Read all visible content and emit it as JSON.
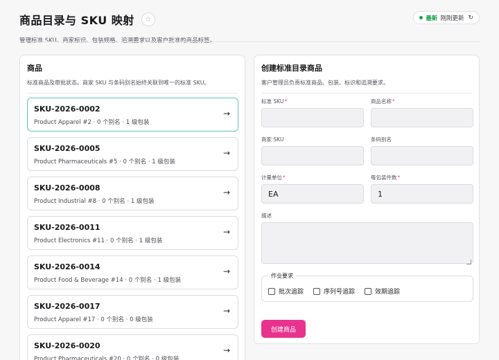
{
  "header": {
    "title": "商品目录与  SKU  映射",
    "star_icon": "star-icon",
    "subtitle": "管理标准 SKU、商家标识、包装规格、追溯要求以及客户批准的商品标签。",
    "status": {
      "badge": "最新",
      "time": "刚刚更新",
      "refresh_icon": "refresh-icon",
      "dot_color": "#16a34a"
    }
  },
  "products_panel": {
    "title": "商品",
    "description": "标准商品及审批状态。商家 SKU 与条码别名始终关联到唯一的标准 SKU。",
    "items": [
      {
        "sku": "SKU-2026-0002",
        "meta": "Product Apparel #2 · 0 个别名 · 1 级包装",
        "selected": true
      },
      {
        "sku": "SKU-2026-0005",
        "meta": "Product Pharmaceuticals #5 · 0 个别名 · 1 级包装",
        "selected": false
      },
      {
        "sku": "SKU-2026-0008",
        "meta": "Product Industrial #8 · 0 个别名 · 1 级包装",
        "selected": false
      },
      {
        "sku": "SKU-2026-0011",
        "meta": "Product Electronics #11 · 0 个别名 · 1 级包装",
        "selected": false
      },
      {
        "sku": "SKU-2026-0014",
        "meta": "Product Food & Beverage #14 · 0 个别名 · 1 级包装",
        "selected": false
      },
      {
        "sku": "SKU-2026-0017",
        "meta": "Product Apparel #17 · 0 个别名 · 0 级包装",
        "selected": false
      },
      {
        "sku": "SKU-2026-0020",
        "meta": "Product Pharmaceuticals #20 · 0 个别名 · 0 级包装",
        "selected": false
      }
    ]
  },
  "create_panel": {
    "title": "创建标准目录商品",
    "description": "客户管理员负责标准商品、包装、标识和追溯要求。",
    "fields": {
      "standard_sku": {
        "label": "标准 SKU",
        "required_mark": "*",
        "value": ""
      },
      "product_name": {
        "label": "商品名称",
        "required_mark": "*",
        "value": ""
      },
      "merchant_sku": {
        "label": "商家 SKU",
        "value": ""
      },
      "barcode_alias": {
        "label": "条码别名",
        "value": ""
      },
      "unit": {
        "label": "计量单位",
        "required_mark": "*",
        "value": "EA"
      },
      "units_per_pack": {
        "label": "每包装件数",
        "required_mark": "*",
        "value": "1"
      },
      "description": {
        "label": "描述",
        "value": ""
      }
    },
    "requirements": {
      "legend": "作业要求",
      "options": [
        {
          "label": "批次追踪",
          "checked": false
        },
        {
          "label": "序列号追踪",
          "checked": false
        },
        {
          "label": "效期追踪",
          "checked": false
        }
      ]
    },
    "submit_label": "创建商品"
  },
  "colors": {
    "accent": "#e8338e",
    "selected_border": "#5ec7b3",
    "success": "#16a34a"
  }
}
